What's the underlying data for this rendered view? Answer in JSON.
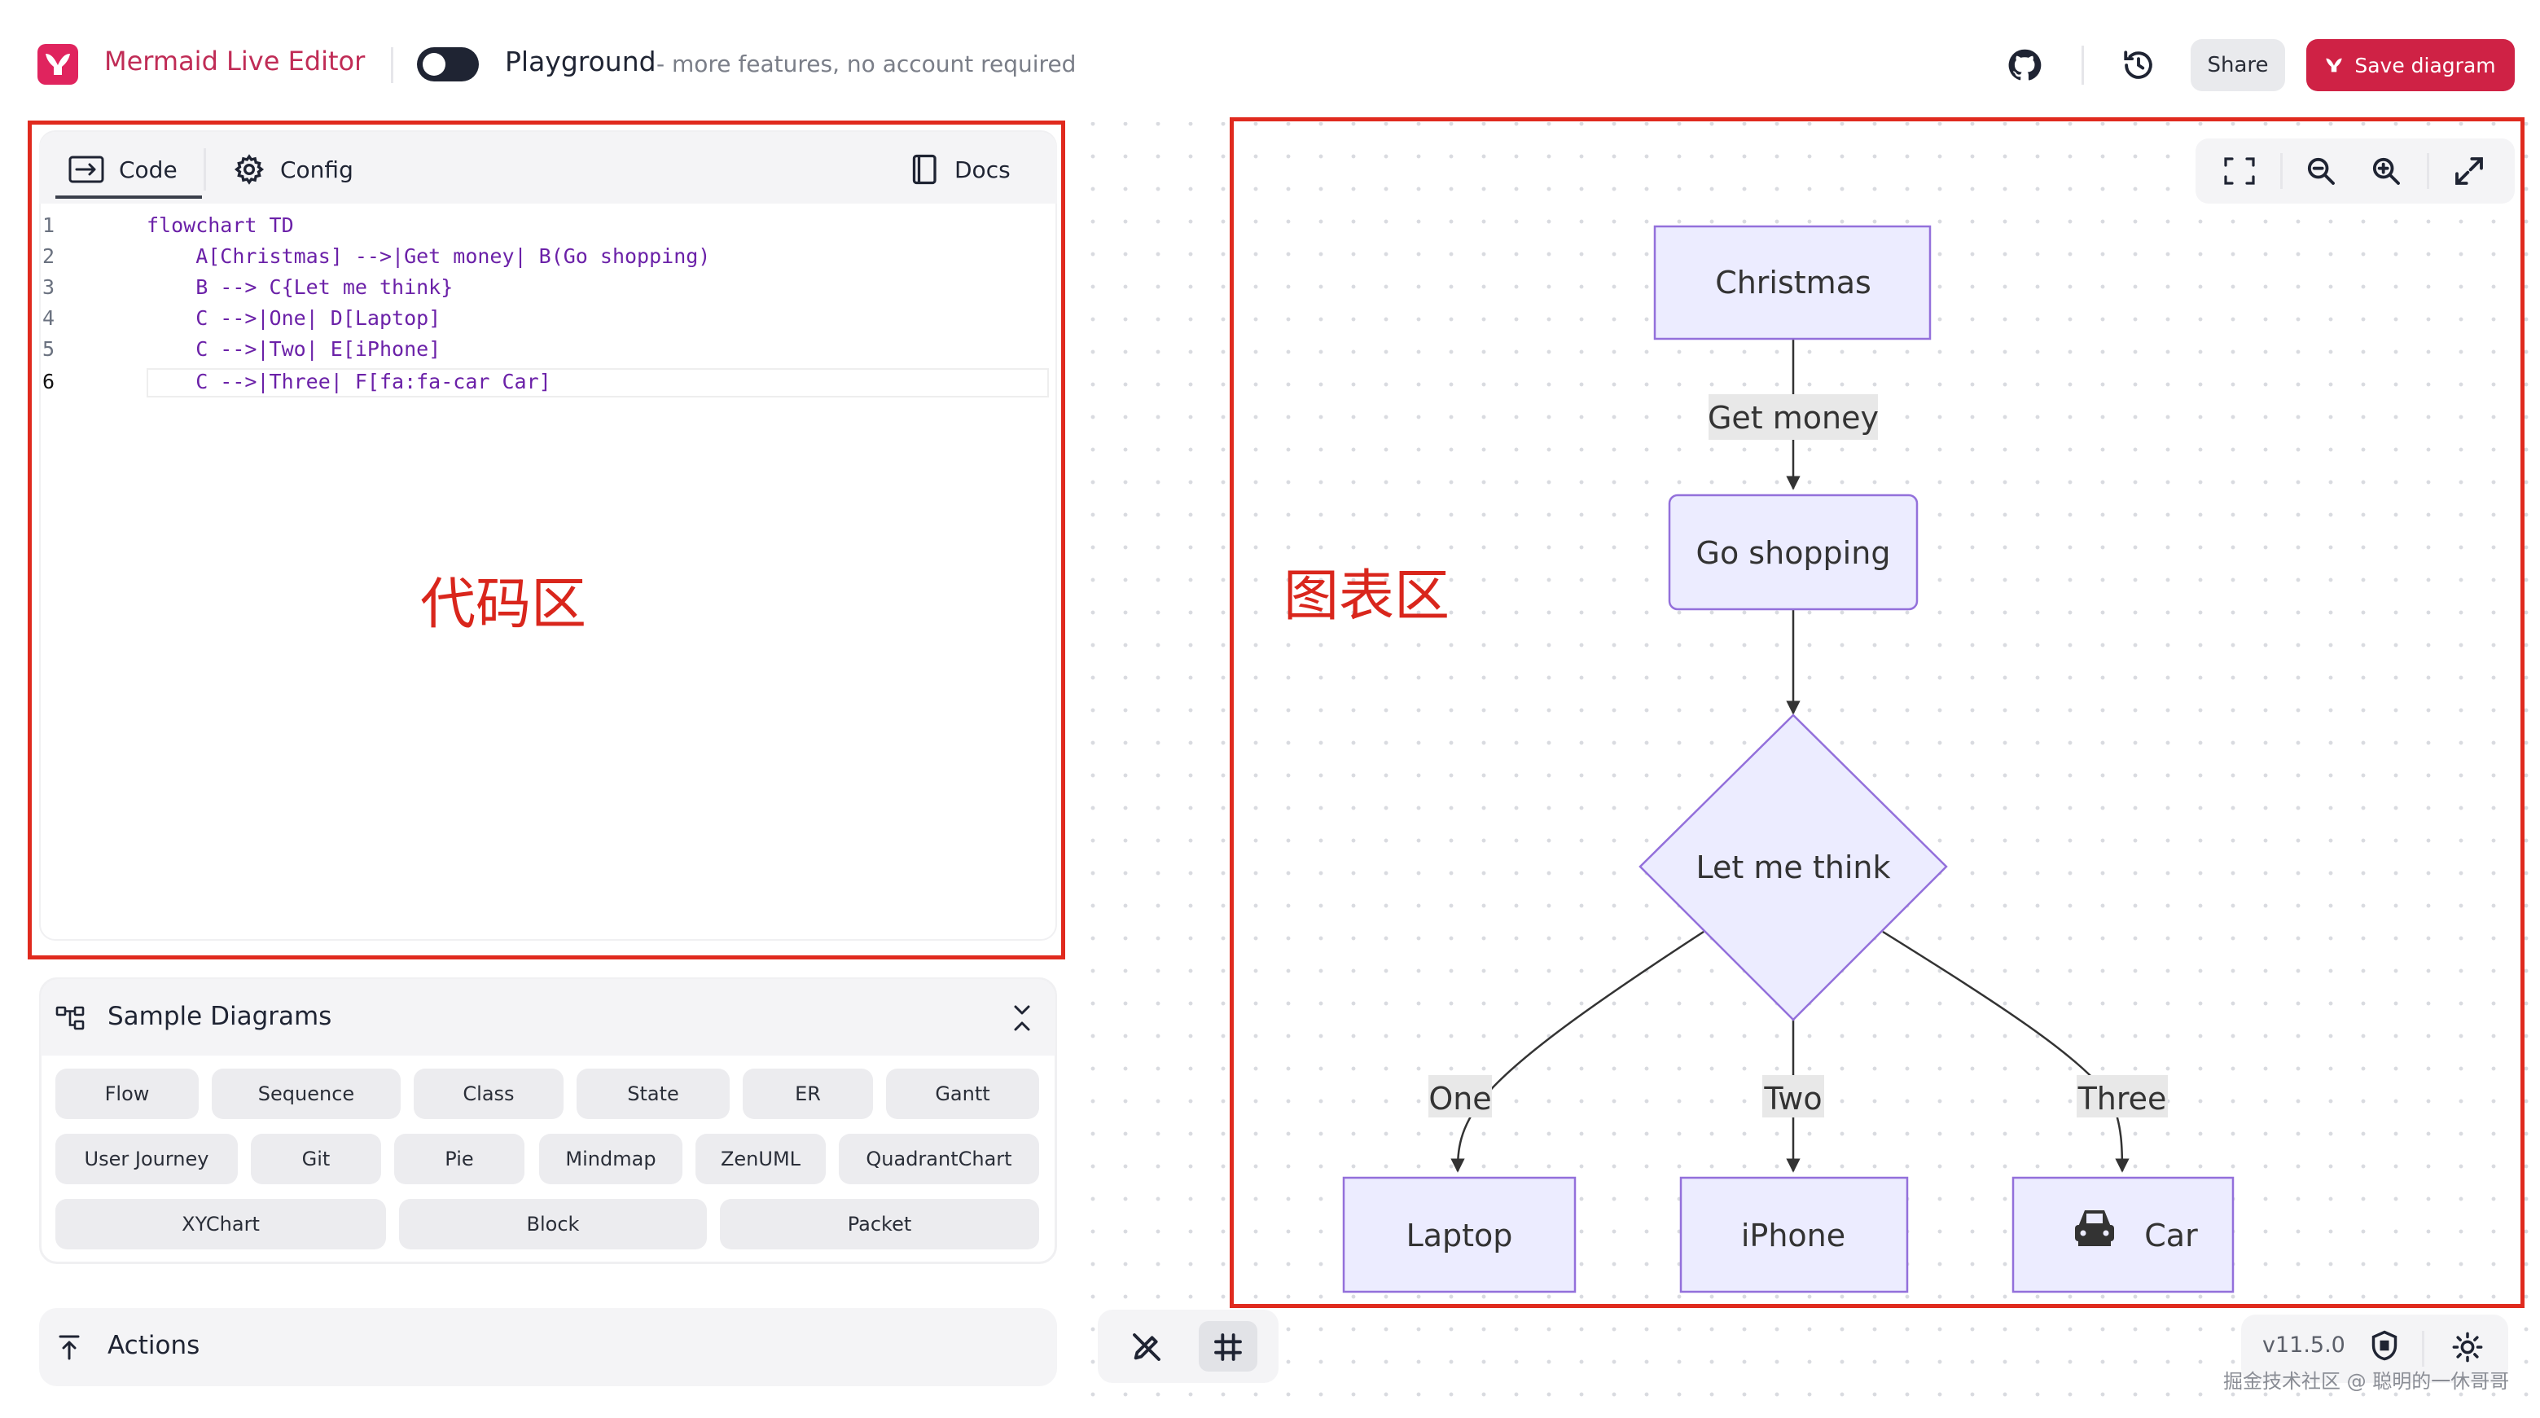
{
  "header": {
    "app_title": "Mermaid Live Editor",
    "playground_label": "Playground",
    "playground_sub": "- more features, no account required",
    "share_label": "Share",
    "save_label": "Save diagram"
  },
  "editor": {
    "tabs": [
      {
        "label": "Code",
        "icon": "terminal-icon",
        "active": true
      },
      {
        "label": "Config",
        "icon": "gear-icon",
        "active": false
      }
    ],
    "docs_label": "Docs",
    "active_line": 6,
    "lines": [
      {
        "num": "1",
        "text": "flowchart TD"
      },
      {
        "num": "2",
        "text": "    A[Christmas] -->|Get money| B(Go shopping)"
      },
      {
        "num": "3",
        "text": "    B --> C{Let me think}"
      },
      {
        "num": "4",
        "text": "    C -->|One| D[Laptop]"
      },
      {
        "num": "5",
        "text": "    C -->|Two| E[iPhone]"
      },
      {
        "num": "6",
        "text": "    C -->|Three| F[fa:fa-car Car]"
      }
    ],
    "annotation": "代码区"
  },
  "samples": {
    "title": "Sample Diagrams",
    "items": [
      "Flow",
      "Sequence",
      "Class",
      "State",
      "ER",
      "Gantt",
      "User Journey",
      "Git",
      "Pie",
      "Mindmap",
      "ZenUML",
      "QuadrantChart",
      "XYChart",
      "Block",
      "Packet"
    ]
  },
  "actions": {
    "title": "Actions"
  },
  "diagram": {
    "annotation": "图表区",
    "nodes": {
      "a": "Christmas",
      "b": "Go shopping",
      "c": "Let me think",
      "d": "Laptop",
      "e": "iPhone",
      "f": "Car"
    },
    "edge_labels": {
      "ab": "Get money",
      "cd": "One",
      "ce": "Two",
      "cf": "Three"
    },
    "car_icon": "car-icon"
  },
  "footer": {
    "version": "v11.5.0",
    "watermark": "掘金技术社区 @ 聪明的一休哥哥"
  },
  "colors": {
    "brand": "#e0245e",
    "save_button": "#cf2245",
    "annotation_red": "#e02a1e",
    "node_fill": "#ececff",
    "node_stroke": "#9370db"
  }
}
